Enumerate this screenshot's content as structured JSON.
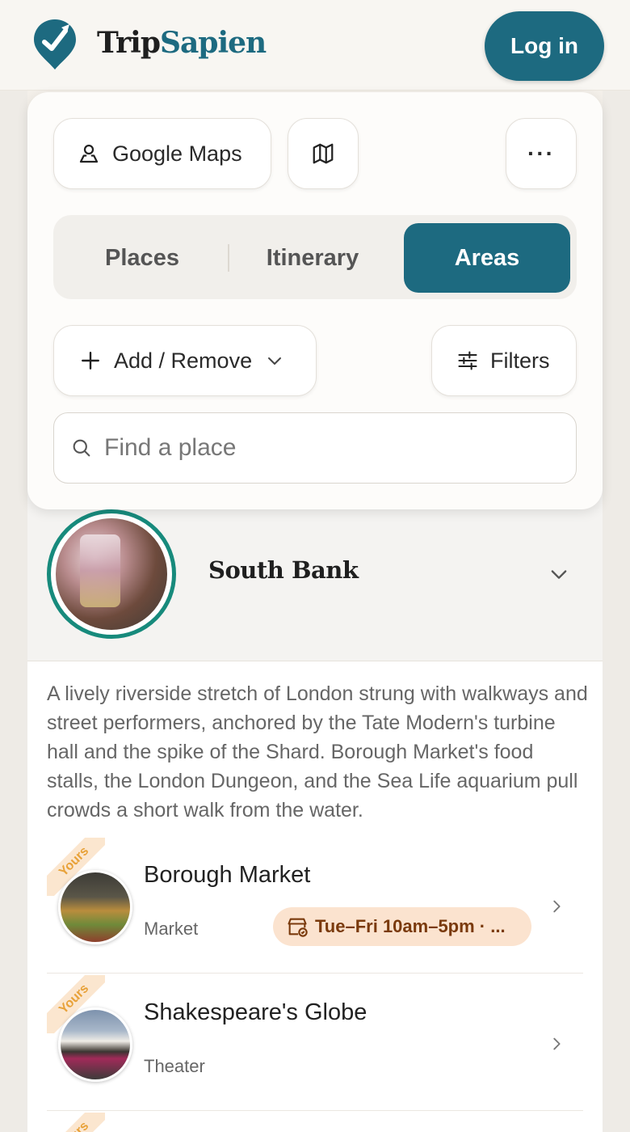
{
  "header": {
    "brand_part1": "Trip",
    "brand_part2": "Sapien",
    "login_label": "Log in",
    "brand_color": "#1d6a80"
  },
  "toolbar": {
    "google_maps_label": "Google Maps",
    "map_icon": "map-icon",
    "more_label": "···"
  },
  "tabs": [
    {
      "label": "Places",
      "active": false
    },
    {
      "label": "Itinerary",
      "active": false
    },
    {
      "label": "Areas",
      "active": true
    }
  ],
  "actions": {
    "add_remove_label": "Add / Remove",
    "filters_label": "Filters"
  },
  "search": {
    "placeholder": "Find a place",
    "value": ""
  },
  "area": {
    "name": "South Bank",
    "description": "A lively riverside stretch of London strung with walkways and street performers, anchored by the Tate Modern's turbine hall and the spike of the Shard. Borough Market's food stalls, the London Dungeon, and the Sea Life aquarium pull crowds a short walk from the water.",
    "ring_color": "#178a7c"
  },
  "places": [
    {
      "ribbon": "Yours",
      "name": "Borough Market",
      "type": "Market",
      "hours": "Tue–Fri 10am–5pm · ..."
    },
    {
      "ribbon": "Yours",
      "name": "Shakespeare's Globe",
      "type": "Theater"
    },
    {
      "ribbon": "Yours"
    }
  ]
}
